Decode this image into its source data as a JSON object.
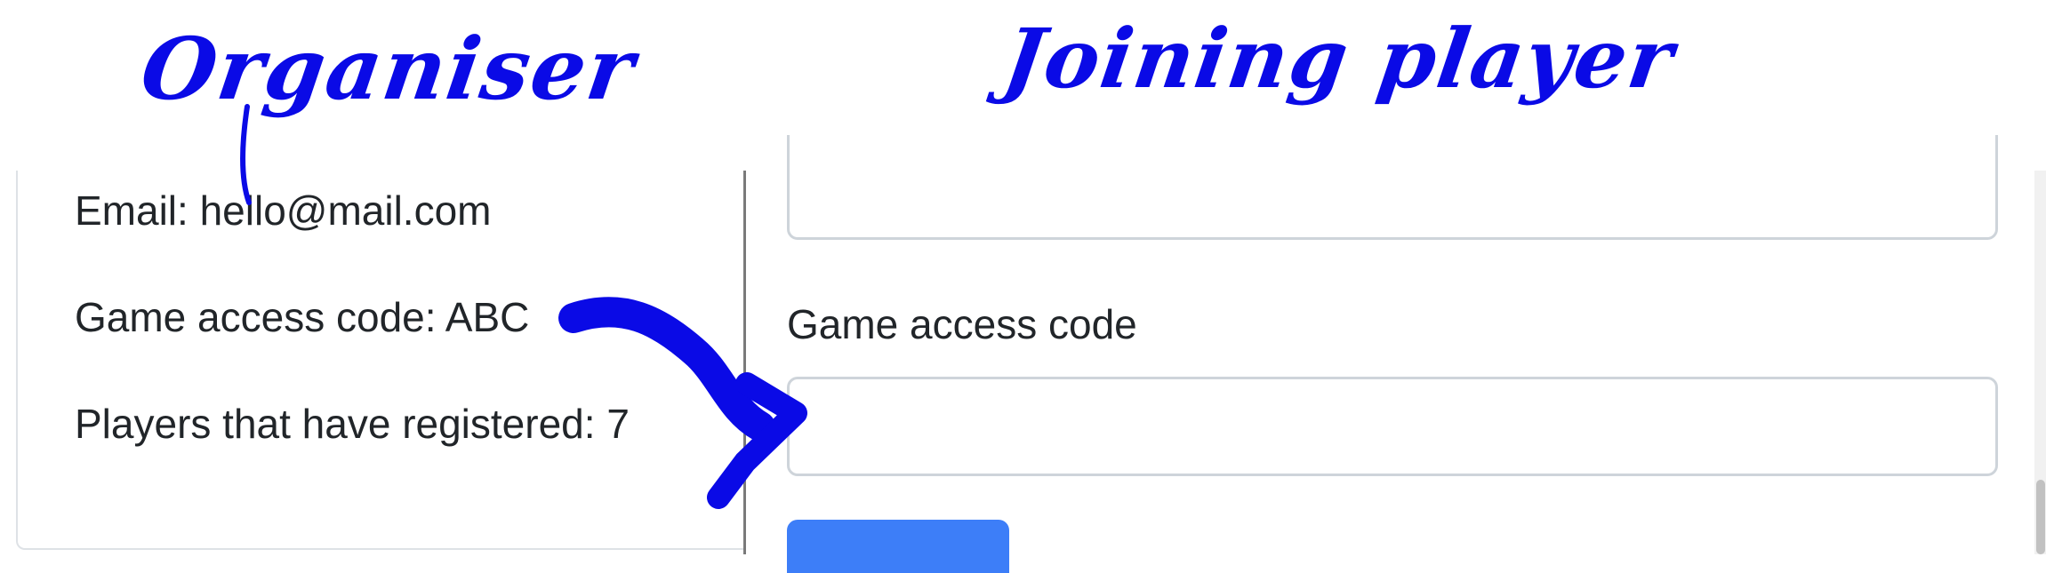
{
  "annotations": {
    "organiser_label": "Organiser",
    "joining_label": "Joining player",
    "ink_color": "#0a0ae6",
    "arrow_icon": "curved-arrow-icon"
  },
  "organiser_card": {
    "email_text": "Email: hello@mail.com",
    "code_text": "Game access code: ABC",
    "players_text": "Players that have registered: 7"
  },
  "join_form": {
    "code_label": "Game access code",
    "code_value": "",
    "button_label": "",
    "button_color": "#3d7ef8"
  }
}
